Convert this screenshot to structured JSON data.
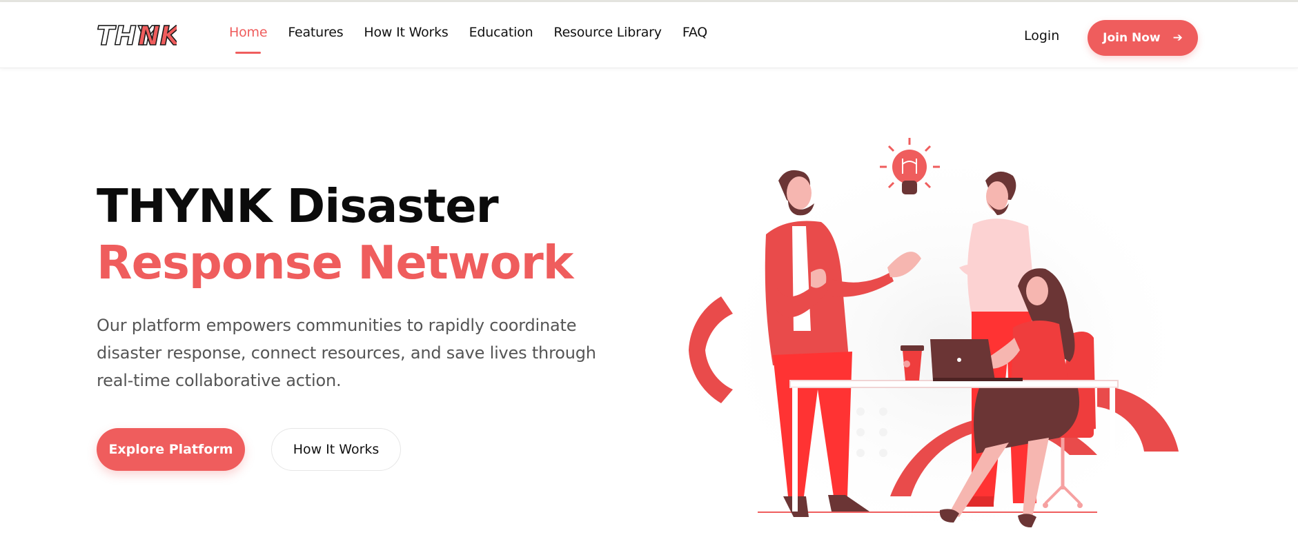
{
  "brand": {
    "logo_text_part1": "THY",
    "logo_text_part2": "NK",
    "accent_color": "#ef5d5d"
  },
  "nav": {
    "items": [
      {
        "label": "Home",
        "active": true
      },
      {
        "label": "Features",
        "active": false
      },
      {
        "label": "How It Works",
        "active": false
      },
      {
        "label": "Education",
        "active": false
      },
      {
        "label": "Resource Library",
        "active": false
      },
      {
        "label": "FAQ",
        "active": false
      }
    ],
    "login_label": "Login",
    "join_label": "Join Now",
    "join_icon": "arrow-right-icon"
  },
  "hero": {
    "title_line1": "THYNK Disaster",
    "title_line2": "Response Network",
    "description": "Our platform empowers communities to rapidly coordinate disaster response, connect resources, and save lives through real-time collaborative action.",
    "primary_cta": "Explore Platform",
    "secondary_cta": "How It Works"
  },
  "illustration": {
    "subject": "team-collaboration-illustration",
    "icons": [
      "lightbulb-icon",
      "laptop-icon",
      "coffee-cup-icon"
    ]
  }
}
